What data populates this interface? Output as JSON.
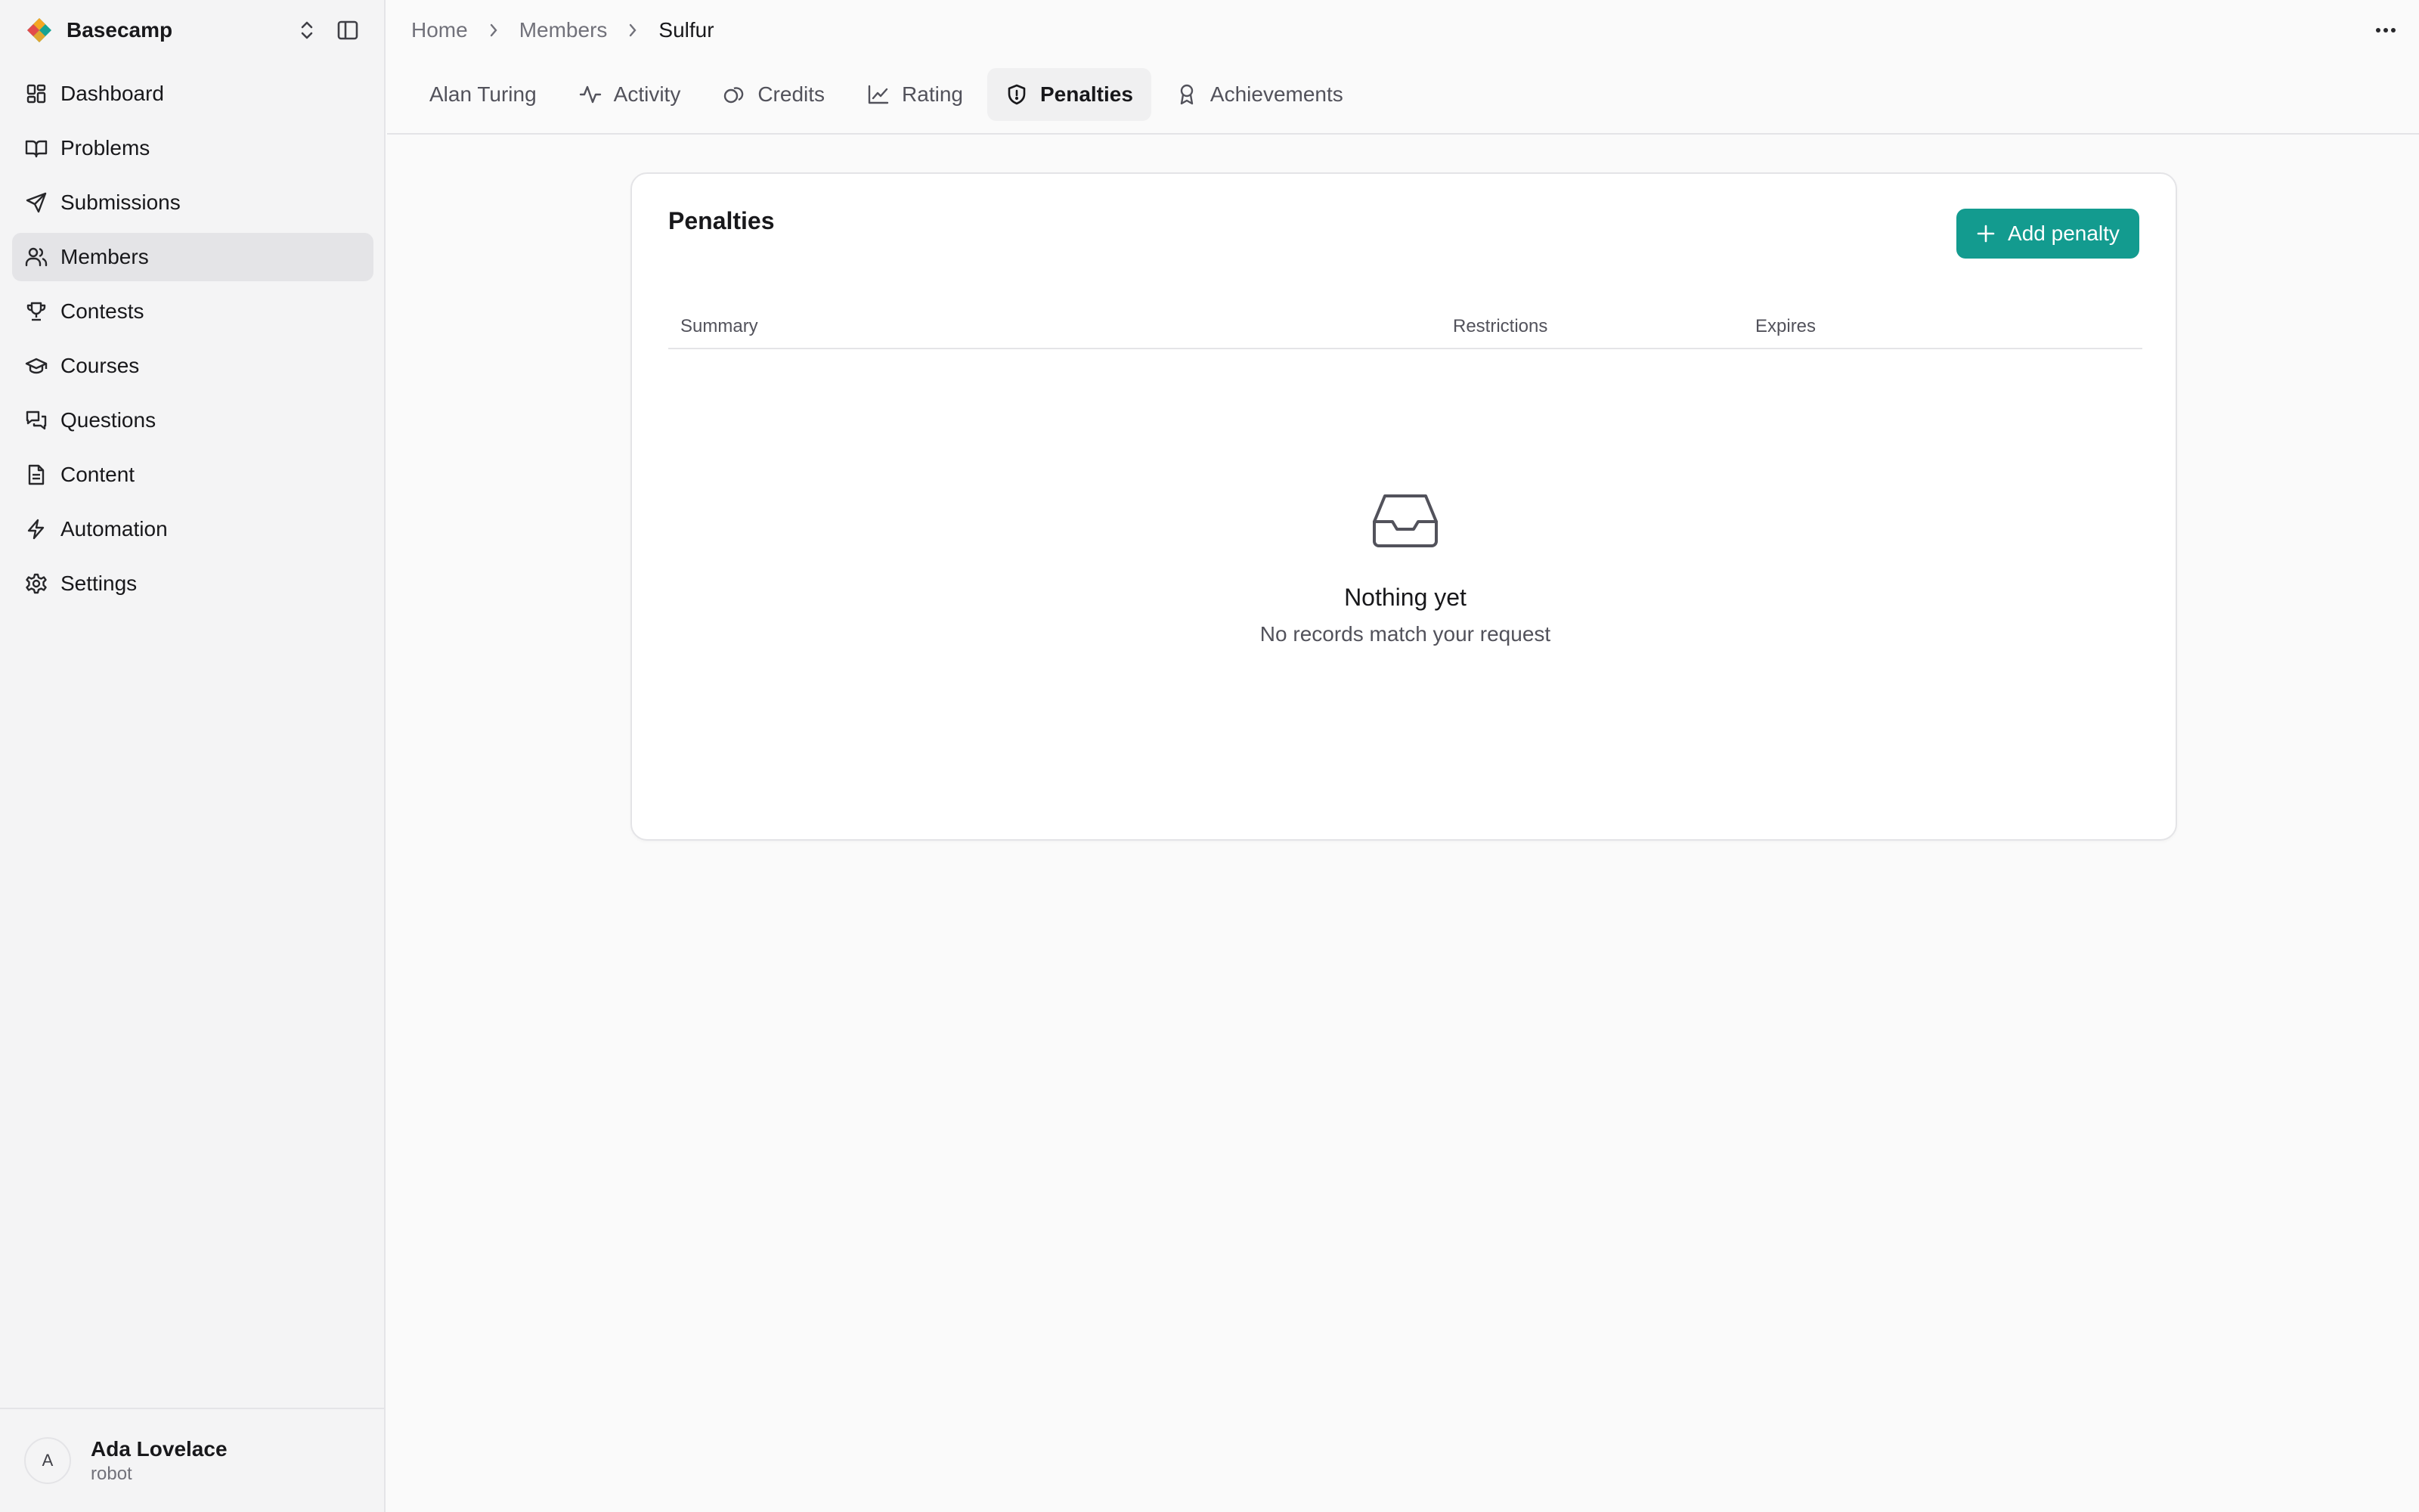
{
  "brand": {
    "name": "Basecamp",
    "accent_colors": [
      "#f5a623",
      "#16a394",
      "#e34b4b"
    ]
  },
  "sidebar": {
    "items": [
      {
        "label": "Dashboard",
        "icon": "dashboard-icon",
        "active": false
      },
      {
        "label": "Problems",
        "icon": "book-open-icon",
        "active": false
      },
      {
        "label": "Submissions",
        "icon": "send-icon",
        "active": false
      },
      {
        "label": "Members",
        "icon": "users-icon",
        "active": true
      },
      {
        "label": "Contests",
        "icon": "trophy-icon",
        "active": false
      },
      {
        "label": "Courses",
        "icon": "graduation-cap-icon",
        "active": false
      },
      {
        "label": "Questions",
        "icon": "messages-icon",
        "active": false
      },
      {
        "label": "Content",
        "icon": "file-text-icon",
        "active": false
      },
      {
        "label": "Automation",
        "icon": "lightning-icon",
        "active": false
      },
      {
        "label": "Settings",
        "icon": "gear-icon",
        "active": false
      }
    ]
  },
  "user": {
    "initial": "A",
    "name": "Ada Lovelace",
    "role": "robot"
  },
  "breadcrumb": {
    "items": [
      "Home",
      "Members",
      "Sulfur"
    ]
  },
  "tabs": [
    {
      "label": "Alan Turing",
      "icon": "",
      "active": false
    },
    {
      "label": "Activity",
      "icon": "activity-icon",
      "active": false
    },
    {
      "label": "Credits",
      "icon": "coins-icon",
      "active": false
    },
    {
      "label": "Rating",
      "icon": "line-chart-icon",
      "active": false
    },
    {
      "label": "Penalties",
      "icon": "shield-icon",
      "active": true
    },
    {
      "label": "Achievements",
      "icon": "award-icon",
      "active": false
    }
  ],
  "penalties": {
    "title": "Penalties",
    "add_label": "Add penalty",
    "accent_color": "#139b8f",
    "columns": [
      "Summary",
      "Restrictions",
      "Expires"
    ],
    "rows": [],
    "empty_title": "Nothing yet",
    "empty_subtitle": "No records match your request",
    "empty_icon": "inbox-icon"
  }
}
